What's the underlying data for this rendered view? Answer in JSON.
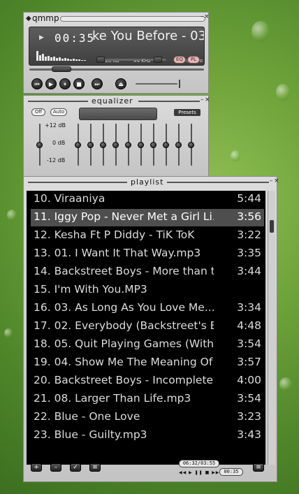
{
  "player": {
    "window_title": "qmmp",
    "time": "00:35",
    "song_title": "ke You Before - 03:",
    "bitrate": "128 Kb",
    "samplerate": "44 KHz",
    "mono": "mono",
    "stereo": "stereo",
    "eq_label": "EQ",
    "pl_label": "PL",
    "volume_level": 0.82
  },
  "equalizer": {
    "title": "equalizer",
    "off_label": "Off",
    "auto_label": "Auto",
    "presets_label": "Presets",
    "db_high": "+12 dB",
    "db_mid": "0 dB",
    "db_low": "-12 dB"
  },
  "playlist": {
    "title": "playlist",
    "selected_index": 1,
    "items": [
      {
        "text": "10. Viraaniya",
        "duration": "5:44"
      },
      {
        "text": "11. Iggy Pop - Never Met a Girl Li...",
        "duration": "3:56"
      },
      {
        "text": "12. Kesha Ft P Diddy - TiK ToK",
        "duration": "3:22"
      },
      {
        "text": "13. 01. I Want It That Way.mp3",
        "duration": "3:35"
      },
      {
        "text": "14. Backstreet Boys - More than t...",
        "duration": "3:44"
      },
      {
        "text": "15. I'm With You.MP3",
        "duration": ""
      },
      {
        "text": "16. 03. As Long As You Love Me....",
        "duration": "3:34"
      },
      {
        "text": "17. 02. Everybody (Backstreet's B...",
        "duration": "4:48"
      },
      {
        "text": "18. 05. Quit Playing Games (With ...",
        "duration": "3:54"
      },
      {
        "text": "19. 04. Show Me The Meaning Of ...",
        "duration": "3:57"
      },
      {
        "text": "20. Backstreet Boys - Incomplete ...",
        "duration": "4:00"
      },
      {
        "text": "21. 08. Larger Than Life.mp3",
        "duration": "3:54"
      },
      {
        "text": "22. Blue - One Love",
        "duration": "3:23"
      },
      {
        "text": "23. Blue - Guilty.mp3",
        "duration": "3:43"
      }
    ],
    "time_readout": "06:32/03:55",
    "elapsed": "00:35"
  }
}
